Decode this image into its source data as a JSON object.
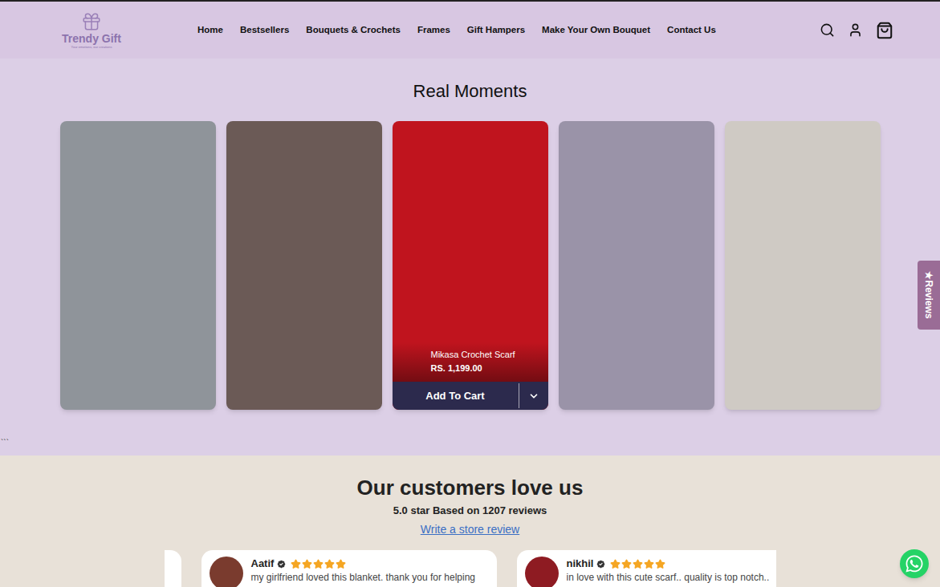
{
  "header": {
    "logo": {
      "name": "Trendy Gift",
      "tagline": "Your emotions, our creations"
    },
    "nav": [
      {
        "label": "Home"
      },
      {
        "label": "Bestsellers"
      },
      {
        "label": "Bouquets & Crochets"
      },
      {
        "label": "Frames"
      },
      {
        "label": "Gift Hampers"
      },
      {
        "label": "Make Your Own Bouquet"
      },
      {
        "label": "Contact Us"
      }
    ]
  },
  "moments": {
    "title": "Real Moments",
    "cards": [
      {
        "kind": "photo",
        "color": "#8f949a"
      },
      {
        "kind": "photo",
        "color": "#6b5a56"
      },
      {
        "kind": "product",
        "color": "#c0141e",
        "product": {
          "name": "Mikasa Crochet Scarf",
          "price": "RS. 1,199.00",
          "button": "Add To Cart"
        }
      },
      {
        "kind": "photo",
        "color": "#9a93a8"
      },
      {
        "kind": "photo",
        "color": "#cfcac4"
      }
    ],
    "stray": "```"
  },
  "reviews": {
    "title": "Our customers love us",
    "summary": "5.0 star Based on 1207 reviews",
    "link": "Write a store review",
    "cards": [
      {
        "name": "Aatif",
        "stars": 5,
        "text": "my girlfriend loved this blanket. thank you for helping",
        "color": "#7a3b2e"
      },
      {
        "name": "nikhil",
        "stars": 5,
        "text": "in love with this cute scarf.. quality is top notch..",
        "color": "#8e1b22"
      }
    ]
  },
  "side_tab": {
    "label": "★Reviews"
  }
}
